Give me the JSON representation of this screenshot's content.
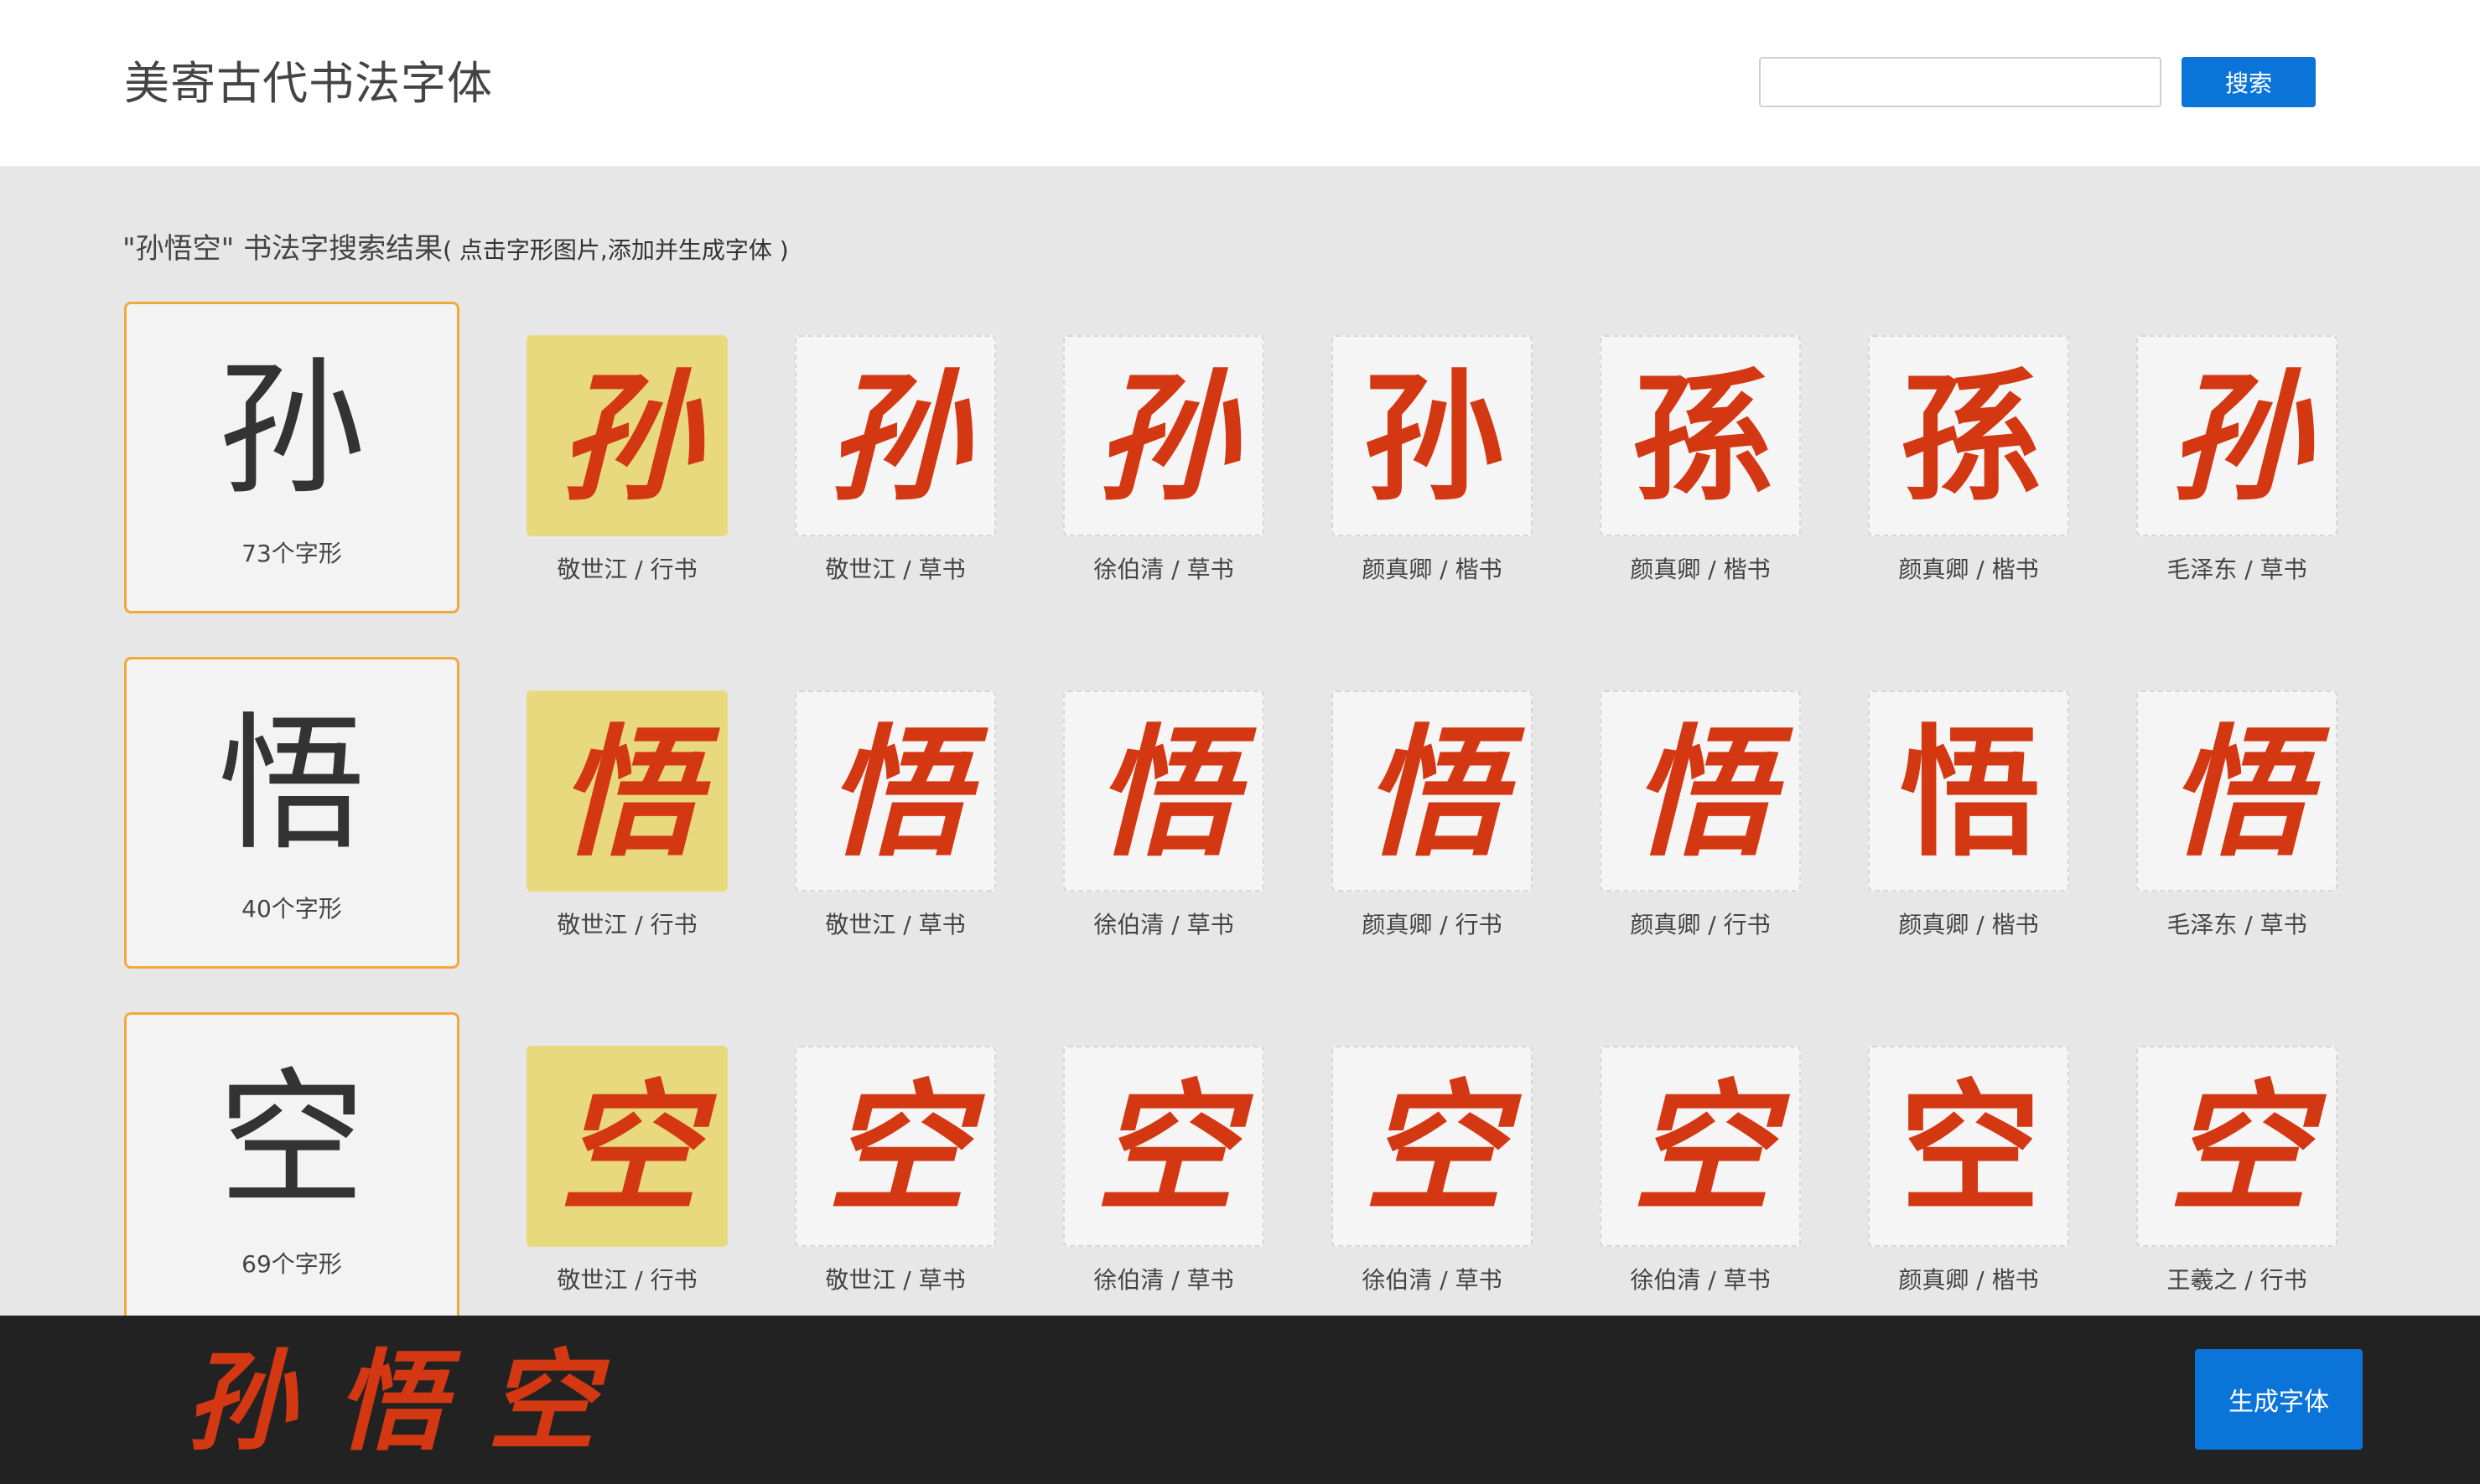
{
  "header": {
    "title": "美寄古代书法字体",
    "search_value": "",
    "search_button": "搜索"
  },
  "results": {
    "query": "\"孙悟空\"",
    "title_suffix": " 书法字搜索结果",
    "hint": "( 点击字形图片,添加并生成字体 )"
  },
  "rows": [
    {
      "char": "孙",
      "count": "73个字形",
      "glyphs": [
        {
          "label": "敬世江 / 行书",
          "selected": true
        },
        {
          "label": "敬世江 / 草书",
          "selected": false
        },
        {
          "label": "徐伯清 / 草书",
          "selected": false
        },
        {
          "label": "颜真卿 / 楷书",
          "selected": false
        },
        {
          "label": "颜真卿 / 楷书",
          "selected": false,
          "display": "孫"
        },
        {
          "label": "颜真卿 / 楷书",
          "selected": false,
          "display": "孫"
        },
        {
          "label": "毛泽东 / 草书",
          "selected": false
        }
      ]
    },
    {
      "char": "悟",
      "count": "40个字形",
      "glyphs": [
        {
          "label": "敬世江 / 行书",
          "selected": true
        },
        {
          "label": "敬世江 / 草书",
          "selected": false
        },
        {
          "label": "徐伯清 / 草书",
          "selected": false
        },
        {
          "label": "颜真卿 / 行书",
          "selected": false
        },
        {
          "label": "颜真卿 / 行书",
          "selected": false
        },
        {
          "label": "颜真卿 / 楷书",
          "selected": false
        },
        {
          "label": "毛泽东 / 草书",
          "selected": false
        }
      ]
    },
    {
      "char": "空",
      "count": "69个字形",
      "glyphs": [
        {
          "label": "敬世江 / 行书",
          "selected": true
        },
        {
          "label": "敬世江 / 草书",
          "selected": false
        },
        {
          "label": "徐伯清 / 草书",
          "selected": false
        },
        {
          "label": "徐伯清 / 草书",
          "selected": false
        },
        {
          "label": "徐伯清 / 草书",
          "selected": false
        },
        {
          "label": "颜真卿 / 楷书",
          "selected": false
        },
        {
          "label": "王羲之 / 行书",
          "selected": false
        }
      ]
    }
  ],
  "footer": {
    "preview_chars": [
      "孙",
      "悟",
      "空"
    ],
    "generate_button": "生成字体"
  },
  "colors": {
    "accent": "#0a74d9",
    "card_border": "#f2a93b",
    "selected_glyph_bg": "#e8d97f",
    "glyph_ink": "#d43813",
    "footer_bg": "#222222"
  }
}
